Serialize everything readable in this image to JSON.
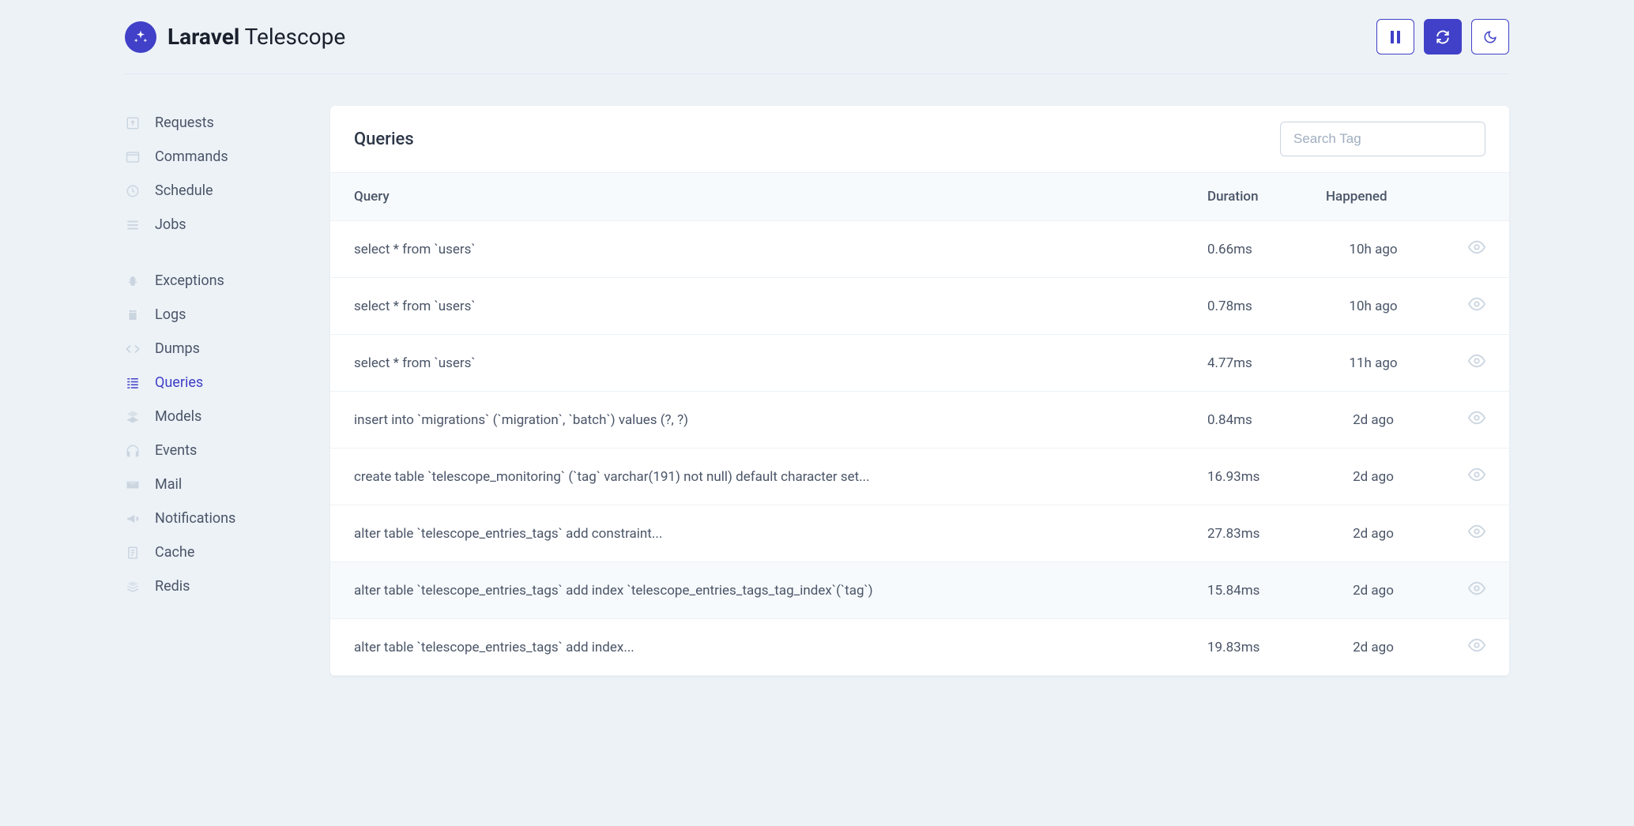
{
  "brand": {
    "bold": "Laravel",
    "light": "Telescope"
  },
  "sidebar": {
    "groups": [
      {
        "items": [
          {
            "label": "Requests",
            "icon": "request",
            "active": false
          },
          {
            "label": "Commands",
            "icon": "terminal",
            "active": false
          },
          {
            "label": "Schedule",
            "icon": "clock",
            "active": false
          },
          {
            "label": "Jobs",
            "icon": "list",
            "active": false
          }
        ]
      },
      {
        "items": [
          {
            "label": "Exceptions",
            "icon": "bug",
            "active": false
          },
          {
            "label": "Logs",
            "icon": "file",
            "active": false
          },
          {
            "label": "Dumps",
            "icon": "code",
            "active": false
          },
          {
            "label": "Queries",
            "icon": "queries",
            "active": true
          },
          {
            "label": "Models",
            "icon": "layers",
            "active": false
          },
          {
            "label": "Events",
            "icon": "headphones",
            "active": false
          },
          {
            "label": "Mail",
            "icon": "mail",
            "active": false
          },
          {
            "label": "Notifications",
            "icon": "megaphone",
            "active": false
          },
          {
            "label": "Cache",
            "icon": "clipboard",
            "active": false
          },
          {
            "label": "Redis",
            "icon": "stack",
            "active": false
          }
        ]
      }
    ]
  },
  "page": {
    "title": "Queries",
    "search_placeholder": "Search Tag",
    "columns": {
      "query": "Query",
      "duration": "Duration",
      "happened": "Happened"
    },
    "rows": [
      {
        "query": "select * from `users`",
        "duration": "0.66ms",
        "happened": "10h ago",
        "highlight": false
      },
      {
        "query": "select * from `users`",
        "duration": "0.78ms",
        "happened": "10h ago",
        "highlight": false
      },
      {
        "query": "select * from `users`",
        "duration": "4.77ms",
        "happened": "11h ago",
        "highlight": false
      },
      {
        "query": "insert into `migrations` (`migration`, `batch`) values (?, ?)",
        "duration": "0.84ms",
        "happened": "2d ago",
        "highlight": false
      },
      {
        "query": "create table `telescope_monitoring` (`tag` varchar(191) not null) default character set...",
        "duration": "16.93ms",
        "happened": "2d ago",
        "highlight": false
      },
      {
        "query": "alter table `telescope_entries_tags` add constraint...",
        "duration": "27.83ms",
        "happened": "2d ago",
        "highlight": false
      },
      {
        "query": "alter table `telescope_entries_tags` add index `telescope_entries_tags_tag_index`(`tag`)",
        "duration": "15.84ms",
        "happened": "2d ago",
        "highlight": true
      },
      {
        "query": "alter table `telescope_entries_tags` add index...",
        "duration": "19.83ms",
        "happened": "2d ago",
        "highlight": false
      }
    ]
  }
}
